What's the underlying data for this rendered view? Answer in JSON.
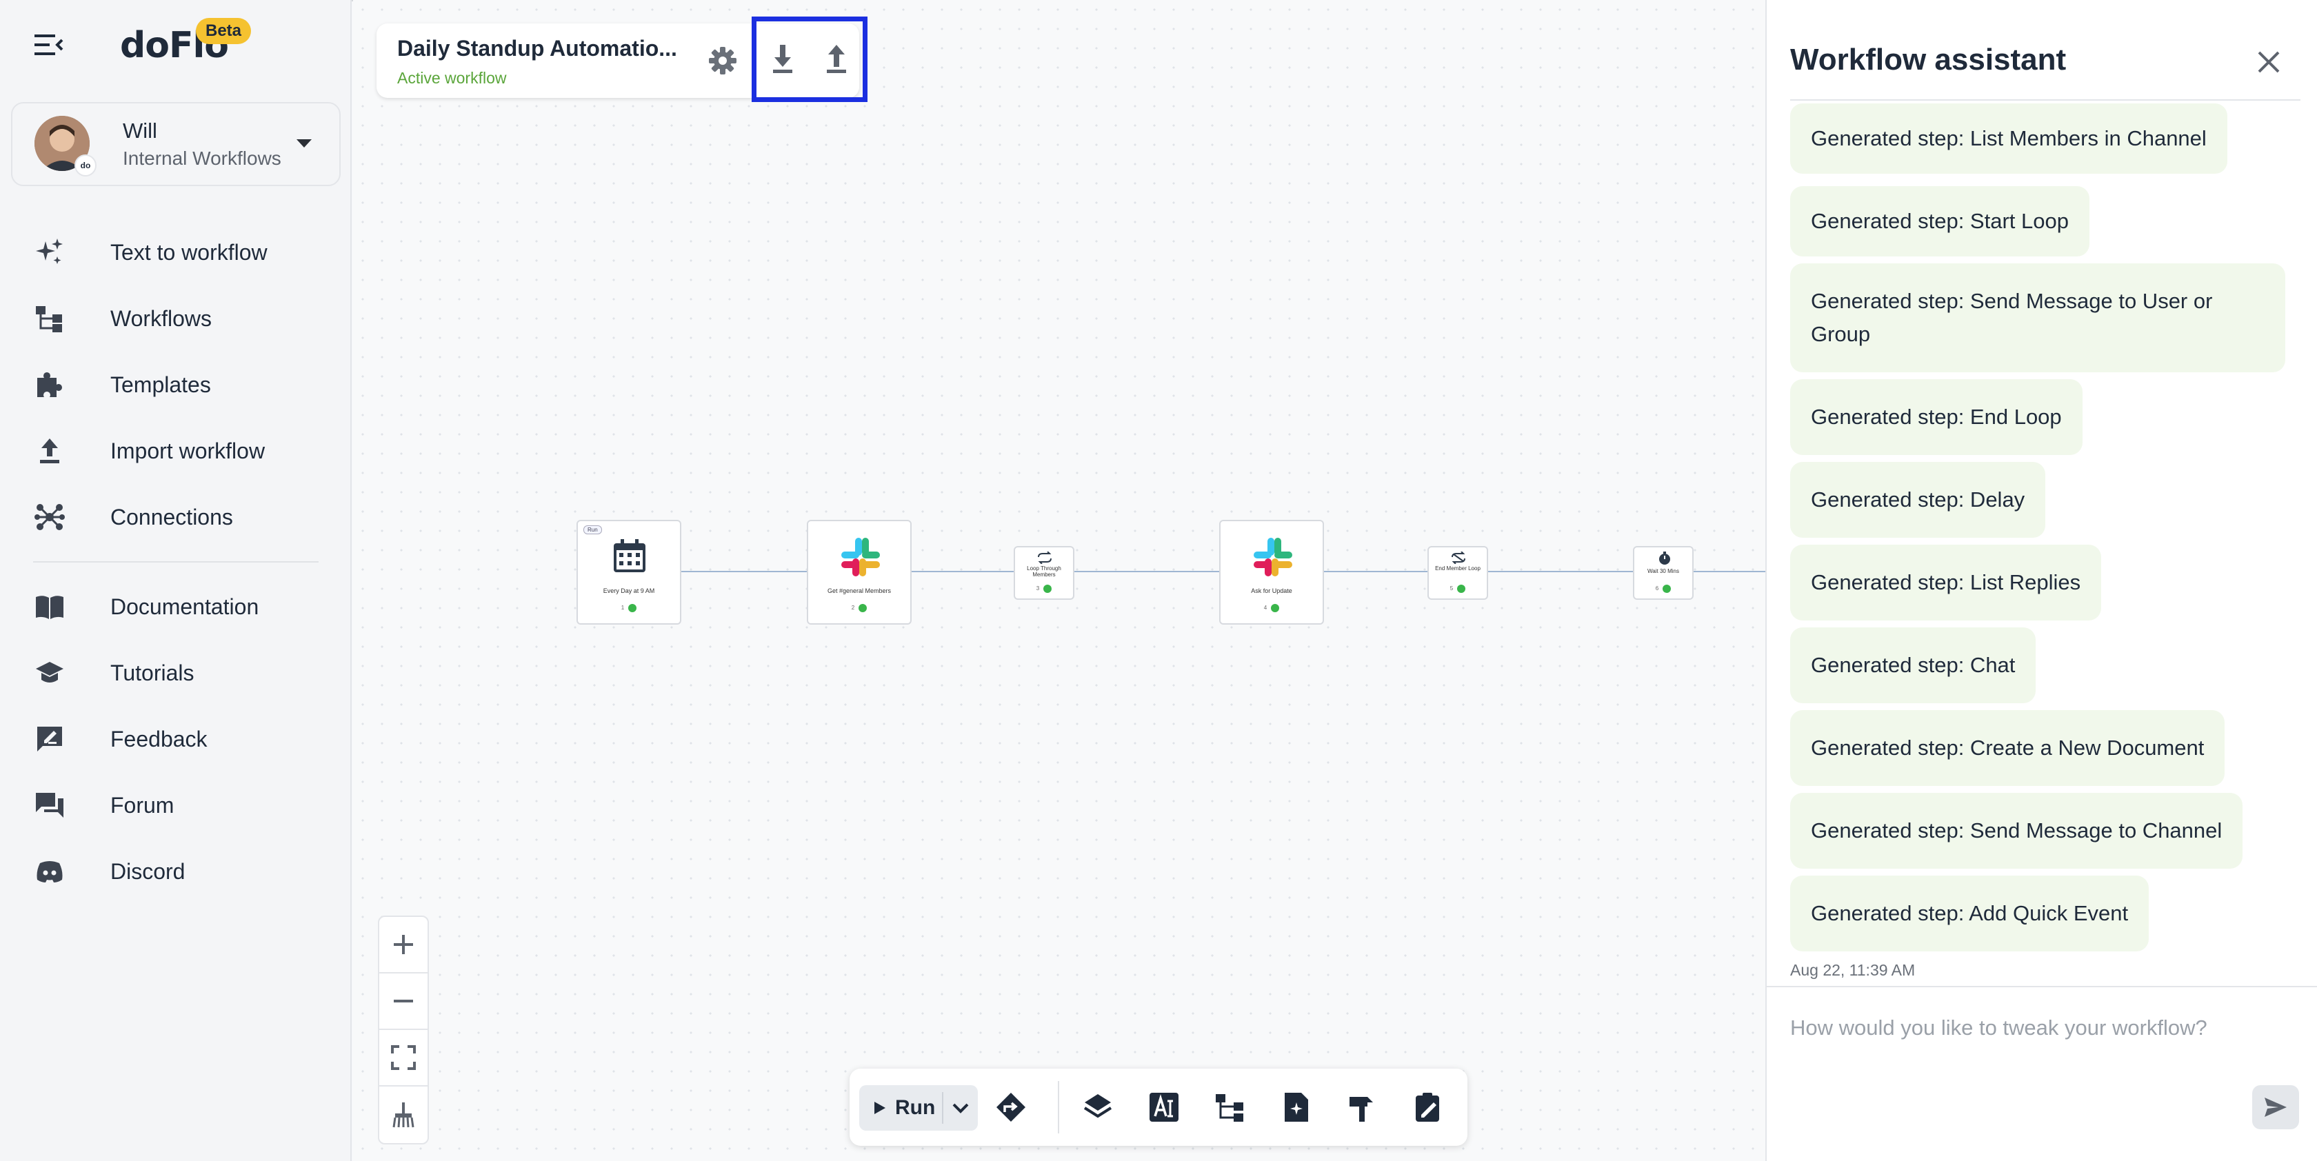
{
  "app": {
    "logo": "doFlo",
    "badge": "Beta"
  },
  "user": {
    "name": "Will",
    "org": "Internal Workflows",
    "avatar_badge": "do"
  },
  "nav": {
    "items": [
      {
        "label": "Text to workflow",
        "icon": "sparkles-icon"
      },
      {
        "label": "Workflows",
        "icon": "workflow-tree-icon"
      },
      {
        "label": "Templates",
        "icon": "puzzle-icon"
      },
      {
        "label": "Import workflow",
        "icon": "upload-icon"
      },
      {
        "label": "Connections",
        "icon": "hub-icon"
      }
    ],
    "secondary": [
      {
        "label": "Documentation",
        "icon": "book-icon"
      },
      {
        "label": "Tutorials",
        "icon": "graduation-cap-icon"
      },
      {
        "label": "Feedback",
        "icon": "feedback-icon"
      },
      {
        "label": "Forum",
        "icon": "forum-icon"
      },
      {
        "label": "Discord",
        "icon": "discord-icon"
      }
    ]
  },
  "workflow": {
    "title": "Daily Standup Automatio...",
    "status": "Active workflow",
    "actions": [
      "settings-icon",
      "download-icon",
      "upload-icon"
    ]
  },
  "nodes": [
    {
      "label": "Every Day at 9 AM",
      "tag": "Run",
      "foot": "1"
    },
    {
      "label": "Get #general Members",
      "foot": "2"
    },
    {
      "label": "Loop Through Members",
      "foot": "3"
    },
    {
      "label": "Ask for Update",
      "foot": "4"
    },
    {
      "label": "End Member Loop",
      "foot": "5"
    },
    {
      "label": "Wait 30 Mins",
      "foot": "6"
    }
  ],
  "toolbar": {
    "run_label": "Run"
  },
  "assistant": {
    "title": "Workflow assistant",
    "messages": [
      "Generated step: List Members in Channel",
      "Generated step: Start Loop",
      "Generated step: Send Message to User or Group",
      "Generated step: End Loop",
      "Generated step: Delay",
      "Generated step: List Replies",
      "Generated step: Chat",
      "Generated step: Create a New Document",
      "Generated step: Send Message to Channel",
      "Generated step: Add Quick Event"
    ],
    "timestamp": "Aug 22, 11:39 AM",
    "input_placeholder": "How would you like to tweak your workflow?"
  },
  "colors": {
    "accent_green": "#5aa53a",
    "highlight_blue": "#1b2fe0",
    "bubble_bg": "#f1f8eb"
  }
}
